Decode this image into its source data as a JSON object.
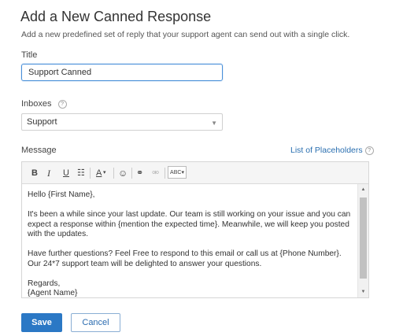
{
  "page": {
    "title": "Add a New Canned Response",
    "subtitle": "Add a new predefined set of reply that your support agent can send out with a single click."
  },
  "form": {
    "title_label": "Title",
    "title_value": "Support Canned",
    "inboxes_label": "Inboxes",
    "inboxes_help": "?",
    "inboxes_value": "Support",
    "message_label": "Message",
    "placeholders_link": "List of Placeholders",
    "placeholders_help": "?"
  },
  "toolbar": {
    "bold": "B",
    "italic": "I",
    "underline": "U",
    "list": "☷",
    "font_color": "A",
    "font_color_caret": "▾",
    "emoji": "☺",
    "link": "⚭",
    "unlink": "⚮",
    "spellcheck": "ABC",
    "spellcheck_caret": "▾"
  },
  "message": {
    "greeting": "Hello {First Name},",
    "para1": "It's been a while since your last update. Our team is still working on your issue and you can expect a response within {mention the expected time}. Meanwhile, we will keep you posted with the updates.",
    "para2": "Have further questions? Feel Free to respond to this email or call us at {Phone Number}. Our 24*7 support team will be delighted to answer your questions.",
    "closing": "Regards,",
    "signature": "{Agent Name}"
  },
  "actions": {
    "save": "Save",
    "cancel": "Cancel"
  }
}
